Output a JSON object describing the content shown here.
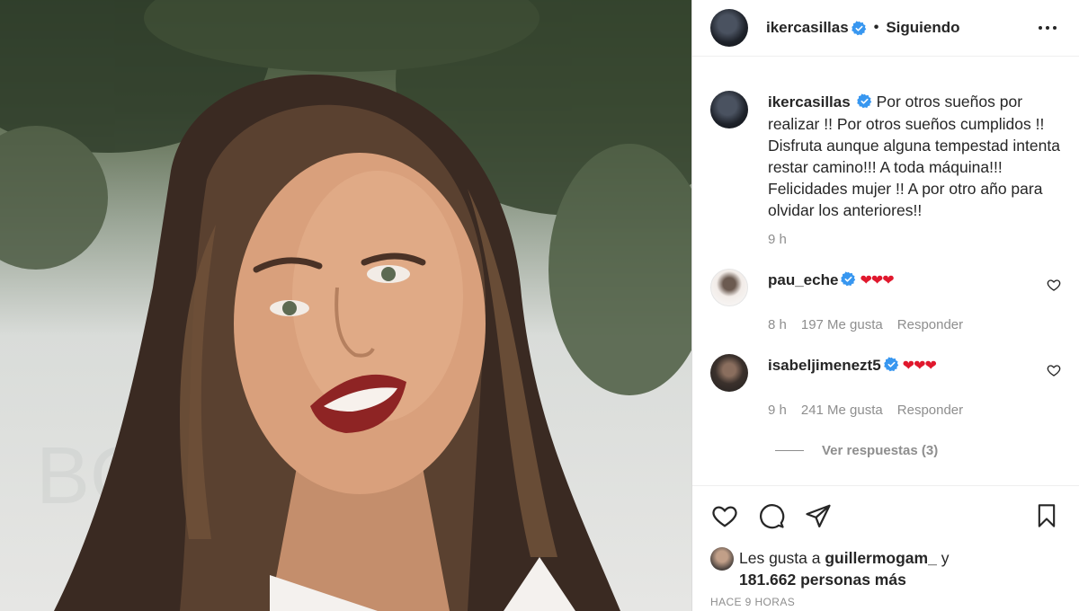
{
  "header": {
    "username": "ikercasillas",
    "separator": "•",
    "follow_label": "Siguiendo"
  },
  "caption": {
    "username": "ikercasillas",
    "text": "Por otros sueños por realizar !! Por otros sueños cumplidos !! Disfruta aunque alguna tempestad intenta restar camino!!! A toda máquina!!! Felicidades mujer !! A por otro año para olvidar los anteriores!!",
    "time": "9 h"
  },
  "comments": [
    {
      "username": "pau_eche",
      "text": "❤❤❤",
      "time": "8 h",
      "likes": "197 Me gusta",
      "reply_label": "Responder"
    },
    {
      "username": "isabeljimenezt5",
      "text": "❤❤❤",
      "time": "9 h",
      "likes": "241 Me gusta",
      "reply_label": "Responder"
    }
  ],
  "view_replies": "Ver respuestas (3)",
  "likes_summary": {
    "prefix": "Les gusta a",
    "user": "guillermogam_",
    "conjunction": "y",
    "others": "181.662 personas más"
  },
  "timestamp": "HACE 9 HORAS",
  "icons": {
    "verified": "verified-badge-icon",
    "like": "heart-icon",
    "comment": "comment-bubble-icon",
    "share": "paper-plane-icon",
    "save": "bookmark-icon",
    "more": "more-options-icon"
  },
  "colors": {
    "verified": "#3897f0",
    "heart_emoji": "#e0182d",
    "muted": "#8e8e8e",
    "text": "#262626"
  }
}
